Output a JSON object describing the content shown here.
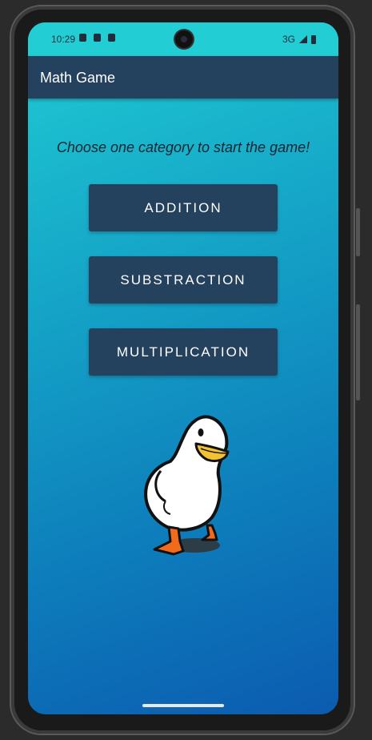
{
  "status_bar": {
    "time": "10:29",
    "network": "3G",
    "icons": [
      "shield-icon",
      "sd-card-icon",
      "a-icon",
      "signal-icon",
      "battery-icon"
    ]
  },
  "app_bar": {
    "title": "Math Game"
  },
  "main": {
    "prompt": "Choose one category to start the game!",
    "buttons": [
      {
        "label": "ADDITION"
      },
      {
        "label": "SUBSTRACTION"
      },
      {
        "label": "MULTIPLICATION"
      }
    ],
    "mascot": "duck-illustration"
  },
  "colors": {
    "app_bar": "#24415e",
    "button": "#24415e",
    "gradient_top": "#1fcbd3",
    "gradient_bottom": "#0c5bb0"
  }
}
